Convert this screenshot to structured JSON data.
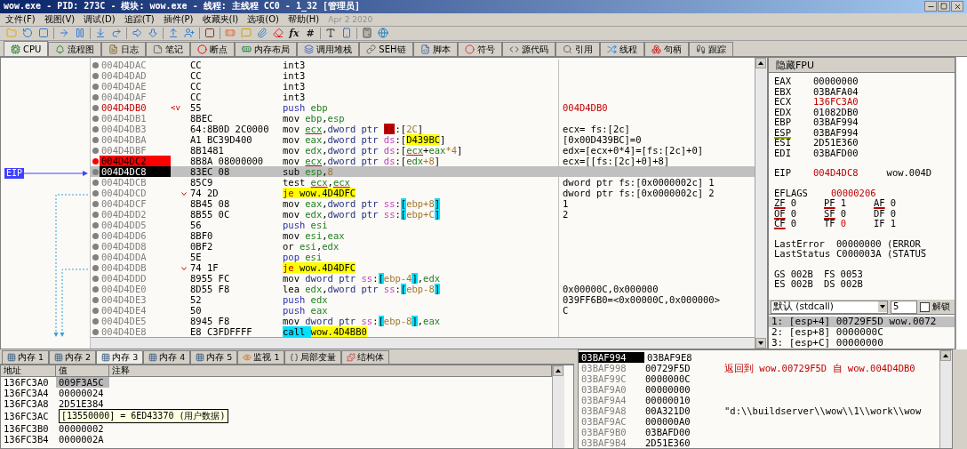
{
  "window": {
    "title": "wow.exe - PID: 273C - 模块: wow.exe - 线程: 主线程 CC0 - 1_32 [管理员]"
  },
  "menu": {
    "items": [
      "文件(F)",
      "视图(V)",
      "调试(D)",
      "追踪(T)",
      "插件(P)",
      "收藏夹(I)",
      "选项(O)",
      "帮助(H)"
    ],
    "build_date": "Apr 2 2020"
  },
  "toolbar": {
    "glyphs": [
      "fx",
      "#"
    ]
  },
  "tabs": [
    {
      "label": "CPU",
      "selected": true
    },
    {
      "label": "流程图",
      "selected": false
    },
    {
      "label": "日志",
      "selected": false
    },
    {
      "label": "笔记",
      "selected": false
    },
    {
      "label": "断点",
      "selected": false
    },
    {
      "label": "内存布局",
      "selected": false
    },
    {
      "label": "调用堆栈",
      "selected": false
    },
    {
      "label": "SEH链",
      "selected": false
    },
    {
      "label": "脚本",
      "selected": false
    },
    {
      "label": "符号",
      "selected": false
    },
    {
      "label": "源代码",
      "selected": false
    },
    {
      "label": "引用",
      "selected": false
    },
    {
      "label": "线程",
      "selected": false
    },
    {
      "label": "句柄",
      "selected": false
    },
    {
      "label": "跟踪",
      "selected": false
    }
  ],
  "disassembly": {
    "eip_label": "EIP",
    "rows": [
      {
        "address": "004D4DAC",
        "kind": "normal",
        "branch": false,
        "bytes": "CC",
        "instruction": [
          {
            "text": "int3",
            "kind": "mn"
          }
        ]
      },
      {
        "address": "004D4DAD",
        "kind": "normal",
        "branch": false,
        "bytes": "CC",
        "instruction": [
          {
            "text": "int3",
            "kind": "mn"
          }
        ]
      },
      {
        "address": "004D4DAE",
        "kind": "normal",
        "branch": false,
        "bytes": "CC",
        "instruction": [
          {
            "text": "int3",
            "kind": "mn"
          }
        ]
      },
      {
        "address": "004D4DAF",
        "kind": "normal",
        "branch": false,
        "bytes": "CC",
        "instruction": [
          {
            "text": "int3",
            "kind": "mn"
          }
        ]
      },
      {
        "address": "004D4DB0",
        "label": "<v",
        "kind": "label",
        "branch": false,
        "bytes": "55",
        "instruction": [
          {
            "text": "push ",
            "kind": "stack"
          },
          {
            "text": "ebp",
            "kind": "reg"
          }
        ],
        "comment": "004D4DB0",
        "color": "#c00000"
      },
      {
        "address": "004D4DB1",
        "kind": "normal",
        "branch": false,
        "bytes": "8BEC",
        "instruction": [
          {
            "text": "mov ",
            "kind": "mn"
          },
          {
            "text": "ebp",
            "kind": "reg"
          },
          {
            "text": ",",
            "kind": "p"
          },
          {
            "text": "esp",
            "kind": "reg"
          }
        ]
      },
      {
        "address": "004D4DB3",
        "kind": "normal",
        "branch": false,
        "bytes": "64:8B0D 2C0000",
        "instruction": [
          {
            "text": "mov ",
            "kind": "mn"
          },
          {
            "text": "ecx",
            "kind": "ureg"
          },
          {
            "text": ",",
            "kind": "p"
          },
          {
            "text": "dword ptr ",
            "kind": "ptr"
          },
          {
            "text": "fs",
            "kind": "fsseg"
          },
          {
            "text": ":[",
            "kind": "p"
          },
          {
            "text": "2C",
            "kind": "num"
          },
          {
            "text": "]",
            "kind": "p"
          }
        ],
        "comment": "ecx= fs:[2c]"
      },
      {
        "address": "004D4DBA",
        "kind": "normal",
        "branch": false,
        "bytes": "A1 BC39D400",
        "instruction": [
          {
            "text": "mov ",
            "kind": "mn"
          },
          {
            "text": "eax",
            "kind": "reg"
          },
          {
            "text": ",",
            "kind": "p"
          },
          {
            "text": "dword ptr ",
            "kind": "ptr"
          },
          {
            "text": "ds",
            "kind": "seg"
          },
          {
            "text": ":[",
            "kind": "p"
          },
          {
            "text": "D439BC",
            "kind": "addr"
          },
          {
            "text": "]",
            "kind": "p"
          }
        ],
        "comment": "[0x00D439BC]=0"
      },
      {
        "address": "004D4DBF",
        "kind": "normal",
        "branch": false,
        "bytes": "8B1481",
        "instruction": [
          {
            "text": "mov ",
            "kind": "mn"
          },
          {
            "text": "edx",
            "kind": "reg"
          },
          {
            "text": ",",
            "kind": "p"
          },
          {
            "text": "dword ptr ",
            "kind": "ptr"
          },
          {
            "text": "ds",
            "kind": "seg"
          },
          {
            "text": ":[",
            "kind": "p"
          },
          {
            "text": "ecx",
            "kind": "ureg"
          },
          {
            "text": "+",
            "kind": "p"
          },
          {
            "text": "eax",
            "kind": "reg"
          },
          {
            "text": "*4",
            "kind": "num"
          },
          {
            "text": "]",
            "kind": "p"
          }
        ],
        "comment": "edx=[ecx+0*4]=[fs:[2c]+0]"
      },
      {
        "address": "004D4DC2",
        "kind": "breakpoint",
        "branch": false,
        "bytes": "8B8A 08000000",
        "instruction": [
          {
            "text": "mov ",
            "kind": "mn"
          },
          {
            "text": "ecx",
            "kind": "ureg"
          },
          {
            "text": ",",
            "kind": "p"
          },
          {
            "text": "dword ptr ",
            "kind": "ptr"
          },
          {
            "text": "ds",
            "kind": "seg"
          },
          {
            "text": ":[",
            "kind": "p"
          },
          {
            "text": "edx",
            "kind": "reg"
          },
          {
            "text": "+8",
            "kind": "num"
          },
          {
            "text": "]",
            "kind": "p"
          }
        ],
        "comment": "ecx=[[fs:[2c]+0]+8]"
      },
      {
        "address": "004D4DC8",
        "kind": "current",
        "branch": false,
        "bytes": "83EC 08",
        "instruction": [
          {
            "text": "sub ",
            "kind": "mn"
          },
          {
            "text": "esp",
            "kind": "reg"
          },
          {
            "text": ",",
            "kind": "p"
          },
          {
            "text": "8",
            "kind": "num"
          }
        ]
      },
      {
        "address": "004D4DCB",
        "kind": "normal",
        "branch": false,
        "bytes": "85C9",
        "instruction": [
          {
            "text": "test ",
            "kind": "mn"
          },
          {
            "text": "ecx",
            "kind": "ureg"
          },
          {
            "text": ",",
            "kind": "p"
          },
          {
            "text": "ecx",
            "kind": "ureg"
          }
        ],
        "comment": "dword ptr fs:[0x0000002c] 1"
      },
      {
        "address": "004D4DCD",
        "kind": "normal",
        "branch": true,
        "bytes": "74 2D",
        "instruction": [
          {
            "text": "je ",
            "kind": "jcc"
          },
          {
            "text": "wow.4D4DFC",
            "kind": "addr"
          }
        ],
        "comment": "dword ptr fs:[0x0000002c] 2"
      },
      {
        "address": "004D4DCF",
        "kind": "normal",
        "branch": false,
        "bytes": "8B45 08",
        "instruction": [
          {
            "text": "mov ",
            "kind": "mn"
          },
          {
            "text": "eax",
            "kind": "reg"
          },
          {
            "text": ",",
            "kind": "p"
          },
          {
            "text": "dword ptr ",
            "kind": "ptr"
          },
          {
            "text": "ss",
            "kind": "seg"
          },
          {
            "text": ":",
            "kind": "p"
          },
          {
            "text": "[",
            "kind": "br"
          },
          {
            "text": "ebp+8",
            "kind": "num"
          },
          {
            "text": "]",
            "kind": "br"
          }
        ],
        "comment": "1"
      },
      {
        "address": "004D4DD2",
        "kind": "normal",
        "branch": false,
        "bytes": "8B55 0C",
        "instruction": [
          {
            "text": "mov ",
            "kind": "mn"
          },
          {
            "text": "edx",
            "kind": "reg"
          },
          {
            "text": ",",
            "kind": "p"
          },
          {
            "text": "dword ptr ",
            "kind": "ptr"
          },
          {
            "text": "ss",
            "kind": "seg"
          },
          {
            "text": ":",
            "kind": "p"
          },
          {
            "text": "[",
            "kind": "br"
          },
          {
            "text": "ebp+C",
            "kind": "num"
          },
          {
            "text": "]",
            "kind": "br"
          }
        ],
        "comment": "2"
      },
      {
        "address": "004D4DD5",
        "kind": "normal",
        "branch": false,
        "bytes": "56",
        "instruction": [
          {
            "text": "push ",
            "kind": "stack"
          },
          {
            "text": "esi",
            "kind": "reg"
          }
        ]
      },
      {
        "address": "004D4DD6",
        "kind": "normal",
        "branch": false,
        "bytes": "8BF0",
        "instruction": [
          {
            "text": "mov ",
            "kind": "mn"
          },
          {
            "text": "esi",
            "kind": "reg"
          },
          {
            "text": ",",
            "kind": "p"
          },
          {
            "text": "eax",
            "kind": "reg"
          }
        ]
      },
      {
        "address": "004D4DD8",
        "kind": "normal",
        "branch": false,
        "bytes": "0BF2",
        "instruction": [
          {
            "text": "or ",
            "kind": "mn"
          },
          {
            "text": "esi",
            "kind": "reg"
          },
          {
            "text": ",",
            "kind": "p"
          },
          {
            "text": "edx",
            "kind": "reg"
          }
        ]
      },
      {
        "address": "004D4DDA",
        "kind": "normal",
        "branch": false,
        "bytes": "5E",
        "instruction": [
          {
            "text": "pop ",
            "kind": "stack"
          },
          {
            "text": "esi",
            "kind": "reg"
          }
        ]
      },
      {
        "address": "004D4DDB",
        "kind": "normal",
        "branch": true,
        "bytes": "74 1F",
        "instruction": [
          {
            "text": "je ",
            "kind": "jcc"
          },
          {
            "text": "wow.4D4DFC",
            "kind": "addr"
          }
        ]
      },
      {
        "address": "004D4DDD",
        "kind": "normal",
        "branch": false,
        "bytes": "8955 FC",
        "instruction": [
          {
            "text": "mov ",
            "kind": "mn"
          },
          {
            "text": "dword ptr ",
            "kind": "ptr"
          },
          {
            "text": "ss",
            "kind": "seg"
          },
          {
            "text": ":",
            "kind": "p"
          },
          {
            "text": "[",
            "kind": "br"
          },
          {
            "text": "ebp-4",
            "kind": "num"
          },
          {
            "text": "]",
            "kind": "br"
          },
          {
            "text": ",",
            "kind": "p"
          },
          {
            "text": "edx",
            "kind": "reg"
          }
        ]
      },
      {
        "address": "004D4DE0",
        "kind": "normal",
        "branch": false,
        "bytes": "8D55 F8",
        "instruction": [
          {
            "text": "lea ",
            "kind": "mn"
          },
          {
            "text": "edx",
            "kind": "reg"
          },
          {
            "text": ",",
            "kind": "p"
          },
          {
            "text": "dword ptr ",
            "kind": "ptr"
          },
          {
            "text": "ss",
            "kind": "seg"
          },
          {
            "text": ":",
            "kind": "p"
          },
          {
            "text": "[",
            "kind": "br"
          },
          {
            "text": "ebp-8",
            "kind": "num"
          },
          {
            "text": "]",
            "kind": "br"
          }
        ],
        "comment": "0x00000C,0x000000"
      },
      {
        "address": "004D4DE3",
        "kind": "normal",
        "branch": false,
        "bytes": "52",
        "instruction": [
          {
            "text": "push ",
            "kind": "stack"
          },
          {
            "text": "edx",
            "kind": "reg"
          }
        ],
        "comment": "039FF6B0=<0x00000C,0x000000>"
      },
      {
        "address": "004D4DE4",
        "kind": "normal",
        "branch": false,
        "bytes": "50",
        "instruction": [
          {
            "text": "push ",
            "kind": "stack"
          },
          {
            "text": "eax",
            "kind": "reg"
          }
        ],
        "comment": "C"
      },
      {
        "address": "004D4DE5",
        "kind": "normal",
        "branch": false,
        "bytes": "8945 F8",
        "instruction": [
          {
            "text": "mov ",
            "kind": "mn"
          },
          {
            "text": "dword ptr ",
            "kind": "ptr"
          },
          {
            "text": "ss",
            "kind": "seg"
          },
          {
            "text": ":",
            "kind": "p"
          },
          {
            "text": "[",
            "kind": "br"
          },
          {
            "text": "ebp-8",
            "kind": "num"
          },
          {
            "text": "]",
            "kind": "br"
          },
          {
            "text": ",",
            "kind": "p"
          },
          {
            "text": "eax",
            "kind": "reg"
          }
        ]
      },
      {
        "address": "004D4DE8",
        "kind": "normal",
        "branch": false,
        "bytes": "E8 C3FDFFFF",
        "instruction": [
          {
            "text": "call ",
            "kind": "call"
          },
          {
            "text": "wow.4D4BB0",
            "kind": "addr"
          }
        ]
      }
    ]
  },
  "registers": {
    "header": "隐藏FPU",
    "general": [
      {
        "name": "EAX",
        "value": "00000000",
        "changed": false,
        "marked": false
      },
      {
        "name": "EBX",
        "value": "03BAFA04",
        "changed": false,
        "marked": false
      },
      {
        "name": "ECX",
        "value": "136FC3A0",
        "changed": true,
        "marked": false
      },
      {
        "name": "EDX",
        "value": "01082DB0",
        "changed": false,
        "marked": false
      },
      {
        "name": "EBP",
        "value": "03BAF994",
        "changed": false,
        "marked": false
      },
      {
        "name": "ESP",
        "value": "03BAF994",
        "changed": false,
        "marked": true
      },
      {
        "name": "ESI",
        "value": "2D51E360",
        "changed": false,
        "marked": false
      },
      {
        "name": "EDI",
        "value": "03BAFD00",
        "changed": false,
        "marked": false
      }
    ],
    "eip": {
      "name": "EIP",
      "value": "004D4DC8",
      "symbol": "wow.004D",
      "changed": true
    },
    "eflags": {
      "name": "EFLAGS",
      "value": "00000206",
      "changed": true
    },
    "flags": [
      [
        {
          "name": "ZF",
          "value": "0",
          "changed": false,
          "marked": true
        },
        {
          "name": "PF",
          "value": "1",
          "changed": false,
          "marked": true
        },
        {
          "name": "AF",
          "value": "0",
          "changed": false,
          "marked": true
        }
      ],
      [
        {
          "name": "OF",
          "value": "0",
          "changed": false,
          "marked": true
        },
        {
          "name": "SF",
          "value": "0",
          "changed": false,
          "marked": true
        },
        {
          "name": "DF",
          "value": "0",
          "changed": false,
          "marked": false
        }
      ],
      [
        {
          "name": "CF",
          "value": "0",
          "changed": false,
          "marked": true
        },
        {
          "name": "TF",
          "value": "0",
          "changed": true,
          "marked": false
        },
        {
          "name": "IF",
          "value": "1",
          "changed": false,
          "marked": false
        }
      ]
    ],
    "status": [
      {
        "name": "LastError",
        "value": "00000000 (ERROR_"
      },
      {
        "name": "LastStatus",
        "value": "C000003A (STATUS"
      }
    ],
    "segments": [
      [
        {
          "name": "GS",
          "value": "002B"
        },
        {
          "name": "FS",
          "value": "0053"
        }
      ],
      [
        {
          "name": "ES",
          "value": "002B"
        },
        {
          "name": "DS",
          "value": "002B"
        }
      ]
    ]
  },
  "call_args": {
    "convention": "默认 (stdcall)",
    "count": "5",
    "unlock": {
      "label": "解锁",
      "checked": false
    },
    "rows": [
      {
        "text": "1: [esp+4] 00729F5D wow.0072",
        "selected": true
      },
      {
        "text": "2: [esp+8] 0000000C",
        "selected": false
      },
      {
        "text": "3: [esp+C] 00000000",
        "selected": false
      }
    ]
  },
  "bottom_tabs": [
    {
      "label": "内存 1",
      "selected": false
    },
    {
      "label": "内存 2",
      "selected": false
    },
    {
      "label": "内存 3",
      "selected": true
    },
    {
      "label": "内存 4",
      "selected": false
    },
    {
      "label": "内存 5",
      "selected": false
    },
    {
      "label": "监视 1",
      "selected": false
    },
    {
      "label": "局部变量",
      "selected": false
    },
    {
      "label": "结构体",
      "selected": false
    }
  ],
  "dump": {
    "columns": [
      "地址",
      "值",
      "注释"
    ],
    "rows": [
      {
        "address": "136FC3A0",
        "value": "009F3A5C",
        "selected": true
      },
      {
        "address": "136FC3A4",
        "value": "00000024",
        "selected": false
      },
      {
        "address": "136FC3A8",
        "value": "2D51E384",
        "selected": false
      },
      {
        "address": "136FC3AC",
        "selected": false
      },
      {
        "address": "136FC3B0",
        "value": "00000002",
        "selected": false
      },
      {
        "address": "136FC3B4",
        "value": "0000002A",
        "selected": false
      }
    ],
    "tooltip": "[13550000] = 6ED43370 (用户数据)"
  },
  "stack": {
    "rows": [
      {
        "address": "03BAF994",
        "value": "03BAF9E8",
        "selected": true
      },
      {
        "address": "03BAF998",
        "value": "00729F5D",
        "comment": "返回到 wow.00729F5D 自 wow.004D4DB0",
        "color": "#c00000",
        "selected": false
      },
      {
        "address": "03BAF99C",
        "value": "0000000C",
        "selected": false
      },
      {
        "address": "03BAF9A0",
        "value": "00000000",
        "selected": false
      },
      {
        "address": "03BAF9A4",
        "value": "00000010",
        "selected": false
      },
      {
        "address": "03BAF9A8",
        "value": "00A321D0",
        "comment": "\"d:\\\\buildserver\\\\wow\\\\1\\\\work\\\\wow",
        "selected": false
      },
      {
        "address": "03BAF9AC",
        "value": "000000A0",
        "selected": false
      },
      {
        "address": "03BAF9B0",
        "value": "03BAFD00",
        "selected": false
      },
      {
        "address": "03BAF9B4",
        "value": "2D51E360",
        "selected": false
      }
    ]
  }
}
